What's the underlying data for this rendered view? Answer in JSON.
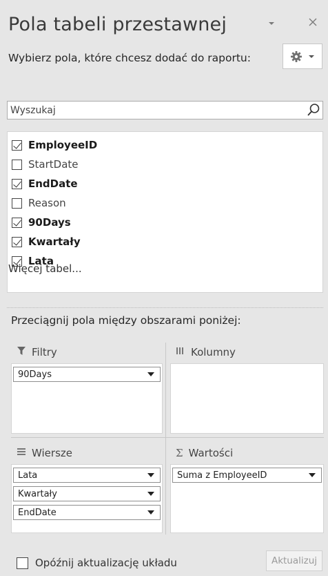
{
  "panel": {
    "title": "Pola tabeli przestawnej",
    "subtitle": "Wybierz pola, które chcesz dodać do raportu:",
    "icons": {
      "dropdown": "chevron-down-icon",
      "close": "close-icon",
      "tools": "gear-icon"
    }
  },
  "search": {
    "placeholder": "Wyszukaj",
    "value": ""
  },
  "fields": [
    {
      "label": "EmployeeID",
      "checked": true
    },
    {
      "label": "StartDate",
      "checked": false
    },
    {
      "label": "EndDate",
      "checked": true
    },
    {
      "label": "Reason",
      "checked": false
    },
    {
      "label": "90Days",
      "checked": true
    },
    {
      "label": "Kwartały",
      "checked": true
    },
    {
      "label": "Lata",
      "checked": true
    }
  ],
  "more_tables": "Więcej tabel...",
  "areas_hint": "Przeciągnij pola między obszarami poniżej:",
  "areas": {
    "filters": {
      "title": "Filtry",
      "icon": "filter-icon",
      "items": [
        "90Days"
      ]
    },
    "columns": {
      "title": "Kolumny",
      "icon": "columns-icon",
      "items": []
    },
    "rows": {
      "title": "Wiersze",
      "icon": "rows-icon",
      "items": [
        "Lata",
        "Kwartały",
        "EndDate"
      ]
    },
    "values": {
      "title": "Wartości",
      "icon": "sigma-icon",
      "items": [
        "Suma z EmployeeID"
      ]
    }
  },
  "footer": {
    "defer_label": "Opóźnij aktualizację układu",
    "defer_checked": false,
    "update_label": "Aktualizuj"
  }
}
